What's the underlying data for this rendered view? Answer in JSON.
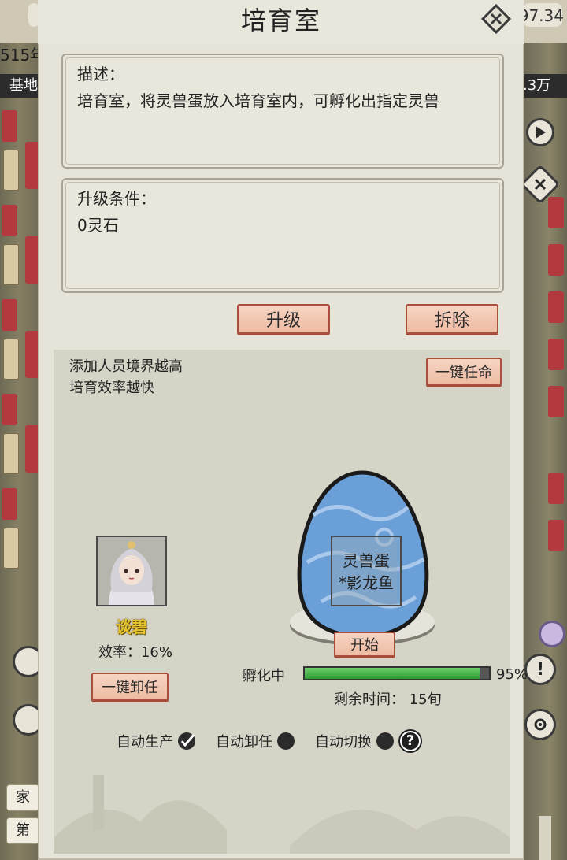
{
  "background": {
    "year_fragment": "515年",
    "base_label_fragment": "基地",
    "resource_fragment": ".3万",
    "top_value": "97.34",
    "bottom_tab_1": "家",
    "bottom_tab_2": "第"
  },
  "dialog": {
    "title": "培育室",
    "description": {
      "header": "描述：",
      "text": "培育室，将灵兽蛋放入培育室内，可孵化出指定灵兽"
    },
    "upgrade": {
      "header": "升级条件：",
      "cost": "0灵石"
    },
    "buttons": {
      "upgrade": "升级",
      "demolish": "拆除",
      "appoint_all": "一键任命",
      "dismiss_all": "一键卸任",
      "start": "开始"
    },
    "hint_line1": "添加人员境界越高",
    "hint_line2": "培育效率越快",
    "staff": {
      "name": "谈碧",
      "efficiency": "效率：16%"
    },
    "egg": {
      "line1": "灵兽蛋",
      "line2": "*影龙鱼"
    },
    "progress": {
      "label": "孵化中",
      "percent_text": "95%",
      "fraction": 0.95,
      "remaining": "剩余时间：  15旬"
    },
    "toggles": {
      "auto_produce": "自动生产",
      "auto_produce_on": true,
      "auto_dismiss": "自动卸任",
      "auto_dismiss_on": false,
      "auto_switch": "自动切换",
      "auto_switch_on": false
    }
  },
  "icons": {
    "close": "close-icon",
    "help": "question-icon",
    "check": "check-icon"
  },
  "colors": {
    "button_fill": "#f3c9b3",
    "button_border": "#a8503c",
    "progress": "#3cb043",
    "name": "#e7c42c"
  }
}
